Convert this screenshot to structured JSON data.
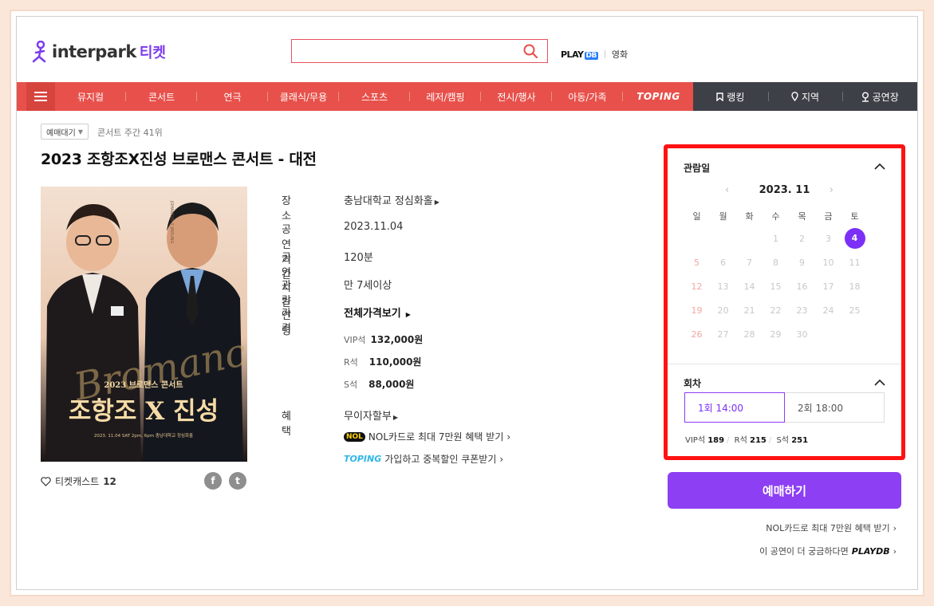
{
  "header": {
    "logo_text": "interpark",
    "logo_ticket": "티켓",
    "search_placeholder": "",
    "playdb_label": "PLAY",
    "playdb_badge": "DB",
    "movie_label": "영화"
  },
  "nav": {
    "items": [
      "뮤지컬",
      "콘서트",
      "연극",
      "클래식/무용",
      "스포츠",
      "레저/캠핑",
      "전시/행사",
      "아동/가족",
      "TOPING"
    ],
    "right_items": [
      "랭킹",
      "지역",
      "공연장"
    ]
  },
  "event": {
    "badge": "예매대기",
    "rank_text": "콘서트 주간 41위",
    "title": "2023 조항조X진성 브로맨스 콘서트 - 대전",
    "poster": {
      "line1": "2023 브로맨스 콘서트",
      "line2": "조항조 X 진성",
      "line3": "2023. 11.04 SAT 2pm, 6pm  충남대학교 정심화홀",
      "script": "Bromance",
      "vertical": "JOHANGJO X JINSUNG"
    },
    "castcast_label": "티켓캐스트",
    "castcast_count": "12",
    "fb": "f",
    "tw": "t"
  },
  "info": {
    "venue_label": "장소",
    "venue_value": "충남대학교 정심화홀",
    "period_label": "공연기간",
    "period_value": "2023.11.04",
    "time_label": "공연시간",
    "time_value": "120분",
    "age_label": "관람연령",
    "age_value": "만 7세이상",
    "price_label": "가격",
    "price_value": "전체가격보기",
    "prices": [
      {
        "grade": "VIP석",
        "price": "132,000원"
      },
      {
        "grade": "R석",
        "price": "110,000원"
      },
      {
        "grade": "S석",
        "price": "88,000원"
      }
    ],
    "benefit_label": "혜택",
    "benefit_value": "무이자할부",
    "nol_logo": "NOL",
    "nol_text": "NOL카드로 최대 7만원 혜택 받기",
    "toping_logo": "TOPING",
    "toping_text": "가입하고 중복할인 쿠폰받기"
  },
  "calendar": {
    "heading": "관람일",
    "month": "2023. 11",
    "dow": [
      "일",
      "월",
      "화",
      "수",
      "목",
      "금",
      "토"
    ],
    "weeks": [
      [
        "",
        "",
        "",
        "1",
        "2",
        "3",
        "4"
      ],
      [
        "5",
        "6",
        "7",
        "8",
        "9",
        "10",
        "11"
      ],
      [
        "12",
        "13",
        "14",
        "15",
        "16",
        "17",
        "18"
      ],
      [
        "19",
        "20",
        "21",
        "22",
        "23",
        "24",
        "25"
      ],
      [
        "26",
        "27",
        "28",
        "29",
        "30",
        "",
        ""
      ]
    ],
    "selected_day": "4",
    "round_heading": "회차",
    "rounds": [
      {
        "label": "1회  14:00",
        "active": true
      },
      {
        "label": "2회  18:00",
        "active": false
      }
    ],
    "seats": [
      {
        "grade": "VIP석",
        "count": "189"
      },
      {
        "grade": "R석",
        "count": "215"
      },
      {
        "grade": "S석",
        "count": "251"
      }
    ]
  },
  "actions": {
    "book_label": "예매하기",
    "nol_link": "NOL카드로 최대 7만원 혜택 받기",
    "playdb_link": "이 공연이 더 궁금하다면",
    "playdb_logo": "PLAYDB"
  },
  "colors": {
    "brand_purple": "#7b2ff7",
    "nav_red": "#e8514b",
    "nav_dark": "#3e4047",
    "highlight_red": "#ff1212"
  }
}
